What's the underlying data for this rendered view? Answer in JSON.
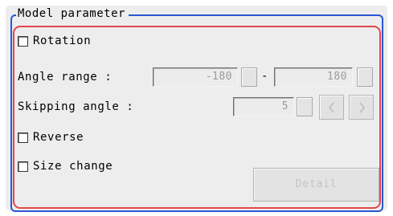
{
  "group": {
    "title": "Model parameter"
  },
  "rotation": {
    "label": "Rotation",
    "checked": false
  },
  "angle_range": {
    "label": "Angle range :",
    "min_value": "-180",
    "separator": "-",
    "max_value": "180"
  },
  "skipping_angle": {
    "label": "Skipping angle :",
    "value": "5",
    "prev_icon": "chevron-left-icon",
    "next_icon": "chevron-right-icon"
  },
  "reverse": {
    "label": "Reverse",
    "checked": false
  },
  "size_change": {
    "label": "Size change",
    "checked": false
  },
  "detail_button": {
    "label": "Detail"
  },
  "colors": {
    "group_border": "#2a56d6",
    "highlight_border": "#e3474a",
    "panel_background": "#ededed"
  }
}
